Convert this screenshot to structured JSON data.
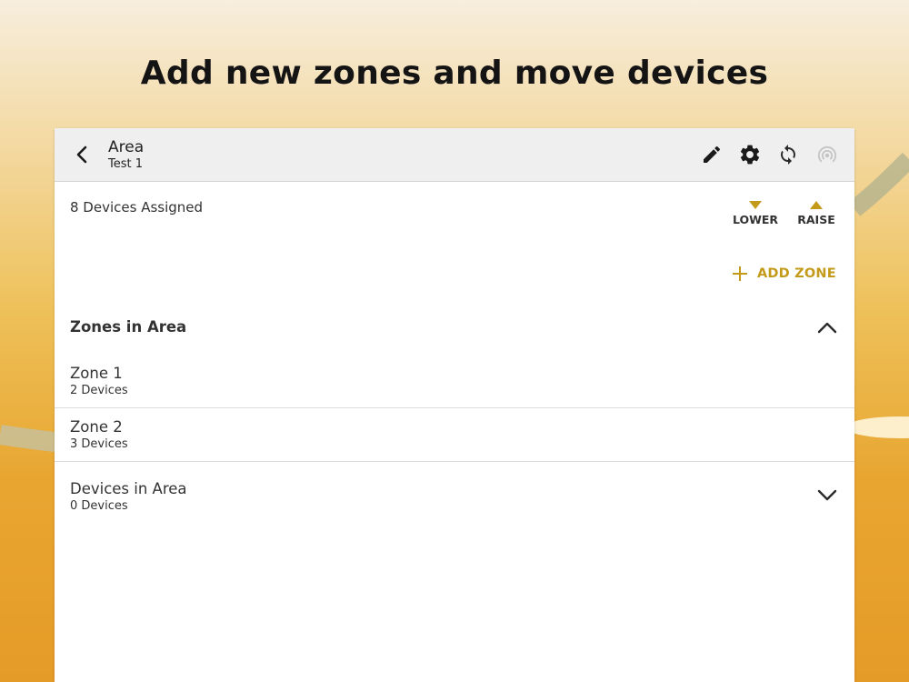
{
  "headline": "Add new zones and move devices",
  "colors": {
    "accent": "#c49a1a",
    "header_bg": "#efefef",
    "text": "#333333"
  },
  "header": {
    "title": "Area",
    "subtitle": "Test 1",
    "icons": [
      "back-arrow-icon",
      "pencil-icon",
      "gear-icon",
      "sync-icon",
      "broadcast-icon"
    ]
  },
  "summary": {
    "devices_assigned": "8 Devices Assigned",
    "lower_label": "LOWER",
    "raise_label": "RAISE"
  },
  "add_zone_label": "ADD ZONE",
  "zones_section": {
    "title": "Zones in Area",
    "expanded": true,
    "zones": [
      {
        "name": "Zone 1",
        "count": "2 Devices"
      },
      {
        "name": "Zone 2",
        "count": "3 Devices"
      }
    ]
  },
  "devices_section": {
    "title": "Devices in Area",
    "count": "0 Devices",
    "expanded": false
  }
}
